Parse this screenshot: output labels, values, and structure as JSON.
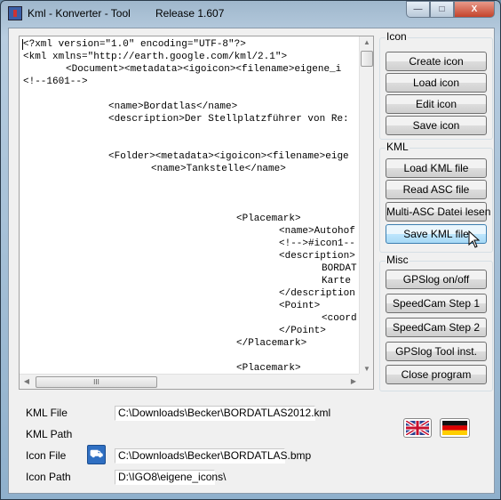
{
  "window": {
    "title": "Kml - Konverter - Tool",
    "release": "Release 1.607",
    "minimize": "—",
    "maximize": "□",
    "close": "X"
  },
  "editor": {
    "lines": [
      "<?xml version=\"1.0\" encoding=\"UTF-8\"?>",
      "<kml xmlns=\"http://earth.google.com/kml/2.1\">",
      "\t<Document><metadata><igoicon><filename>eigene_i",
      "<!--1601-->",
      "",
      "\t\t<name>Bordatlas</name>",
      "\t\t<description>Der Stellplatzführer von Re:",
      "",
      "",
      "\t\t<Folder><metadata><igoicon><filename>eige",
      "\t\t\t<name>Tankstelle</name>",
      "",
      "",
      "",
      "\t\t\t\t\t<Placemark>",
      "\t\t\t\t\t\t<name>Autohof",
      "\t\t\t\t\t\t<!-->#icon1--",
      "\t\t\t\t\t\t<description>",
      "\t\t\t\t\t\t\tBORDAT",
      "\t\t\t\t\t\t\tKarte",
      "\t\t\t\t\t\t</description",
      "\t\t\t\t\t\t<Point>",
      "\t\t\t\t\t\t\t<coord",
      "\t\t\t\t\t\t</Point>",
      "\t\t\t\t\t</Placemark>",
      "",
      "\t\t\t\t\t<Placemark>"
    ],
    "hscroll_grip": "III"
  },
  "groups": {
    "icon": {
      "label": "Icon",
      "buttons": [
        "Create icon",
        "Load icon",
        "Edit icon",
        "Save icon"
      ]
    },
    "kml": {
      "label": "KML",
      "buttons": [
        "Load KML file",
        "Read ASC file",
        "Multi-ASC Datei lesen",
        "Save KML file"
      ]
    },
    "misc": {
      "label": "Misc",
      "buttons": [
        "GPSlog on/off",
        "SpeedCam Step 1",
        "SpeedCam Step 2",
        "GPSlog Tool  inst.",
        "Close program"
      ]
    }
  },
  "fields": {
    "kml_file": {
      "label": "KML File",
      "value": "C:\\Downloads\\Becker\\BORDATLAS2012.kml"
    },
    "kml_path": {
      "label": "KML Path"
    },
    "icon_file": {
      "label": "Icon File",
      "value": "C:\\Downloads\\Becker\\BORDATLAS.bmp"
    },
    "icon_path": {
      "label": "Icon Path",
      "value": "D:\\IGO8\\eigene_icons\\"
    }
  },
  "languages": [
    "english-flag",
    "german-flag"
  ],
  "colors": {
    "hover_button": "#bee6fd",
    "icon_blue": "#2f6fc2"
  }
}
